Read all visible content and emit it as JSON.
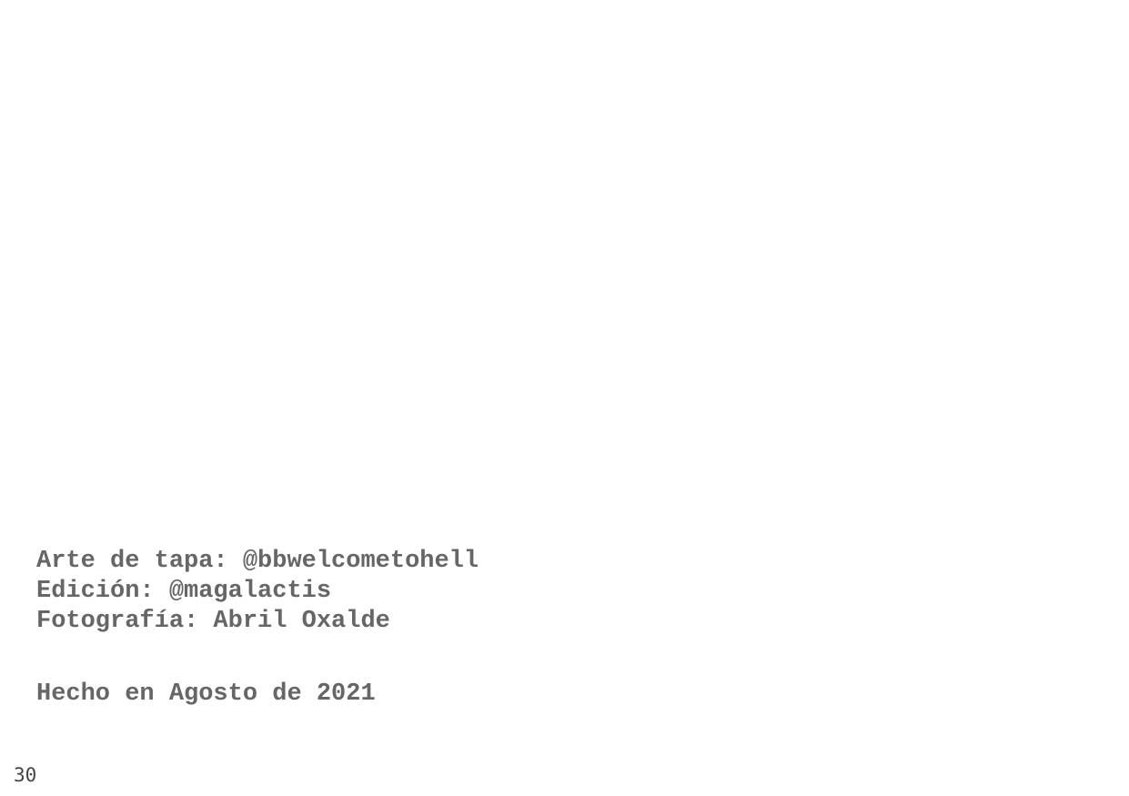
{
  "credits": [
    "Arte de tapa: @bbwelcometohell",
    "Edición: @magalactis",
    "Fotografía: Abril Oxalde"
  ],
  "made_in": "Hecho en Agosto de 2021",
  "page_number": "30",
  "colors": {
    "text": "#666666",
    "page_number": "#444444",
    "background": "#ffffff"
  }
}
